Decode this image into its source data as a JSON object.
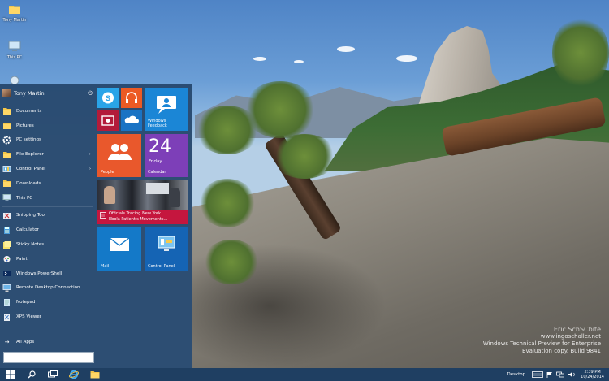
{
  "desktop": {
    "icons": [
      {
        "label": "Tony Martin"
      },
      {
        "label": "This PC"
      },
      {
        "label": ""
      }
    ],
    "watermark": {
      "line1": "Eric SchSCbite",
      "line2": "www.ingoschaller.net",
      "line3": "Windows Technical Preview for Enterprise",
      "line4": "Evaluation copy. Build 9841"
    }
  },
  "start_menu": {
    "user_name": "Tony Martin",
    "places": [
      {
        "label": "Documents",
        "icon": "folder-icon",
        "arrow": false
      },
      {
        "label": "Pictures",
        "icon": "folder-icon",
        "arrow": false
      },
      {
        "label": "PC settings",
        "icon": "gear-icon",
        "arrow": false
      },
      {
        "label": "File Explorer",
        "icon": "folder-icon",
        "arrow": true
      },
      {
        "label": "Control Panel",
        "icon": "control-panel-icon",
        "arrow": true
      },
      {
        "label": "Downloads",
        "icon": "folder-icon",
        "arrow": false
      },
      {
        "label": "This PC",
        "icon": "monitor-icon",
        "arrow": false
      }
    ],
    "apps": [
      {
        "label": "Snipping Tool",
        "icon": "scissors-icon"
      },
      {
        "label": "Calculator",
        "icon": "calculator-icon"
      },
      {
        "label": "Sticky Notes",
        "icon": "sticky-note-icon"
      },
      {
        "label": "Paint",
        "icon": "paint-icon"
      },
      {
        "label": "Windows PowerShell",
        "icon": "powershell-icon"
      },
      {
        "label": "Remote Desktop Connection",
        "icon": "remote-desktop-icon"
      },
      {
        "label": "Notepad",
        "icon": "notepad-icon"
      },
      {
        "label": "XPS Viewer",
        "icon": "xps-icon"
      }
    ],
    "all_apps_label": "All Apps",
    "search_placeholder": ""
  },
  "tiles": {
    "skype": {
      "icon": "skype-icon",
      "color": "#2aa4e8"
    },
    "music": {
      "icon": "headphones-icon",
      "color": "#ec5a24"
    },
    "video": {
      "icon": "video-icon",
      "color": "#b31b3a"
    },
    "onedrive": {
      "icon": "cloud-icon",
      "color": "#1a73c4"
    },
    "feedback": {
      "label": "Windows Feedback",
      "icon": "feedback-icon",
      "color": "#1b86d6"
    },
    "people": {
      "label": "People",
      "icon": "people-icon",
      "color": "#e9582c"
    },
    "calendar": {
      "date": "24",
      "day": "Friday",
      "label": "Calendar",
      "color": "#7d3fb8"
    },
    "news": {
      "headline_line1": "Officials Tracing New York",
      "headline_line2": "Ebola Patient's Movements...",
      "color": "#c5163e"
    },
    "mail": {
      "label": "Mail",
      "icon": "mail-icon",
      "color": "#1479c8"
    },
    "control_panel": {
      "label": "Control Panel",
      "icon": "control-panel-icon",
      "color": "#1564b4"
    }
  },
  "taskbar": {
    "desktop_label": "Desktop",
    "time": "2:39 PM",
    "date": "10/24/2014"
  },
  "colors": {
    "start_menu_bg": "#28496e",
    "taskbar_bg": "#1f3f62",
    "accent": "#1b86d6"
  }
}
